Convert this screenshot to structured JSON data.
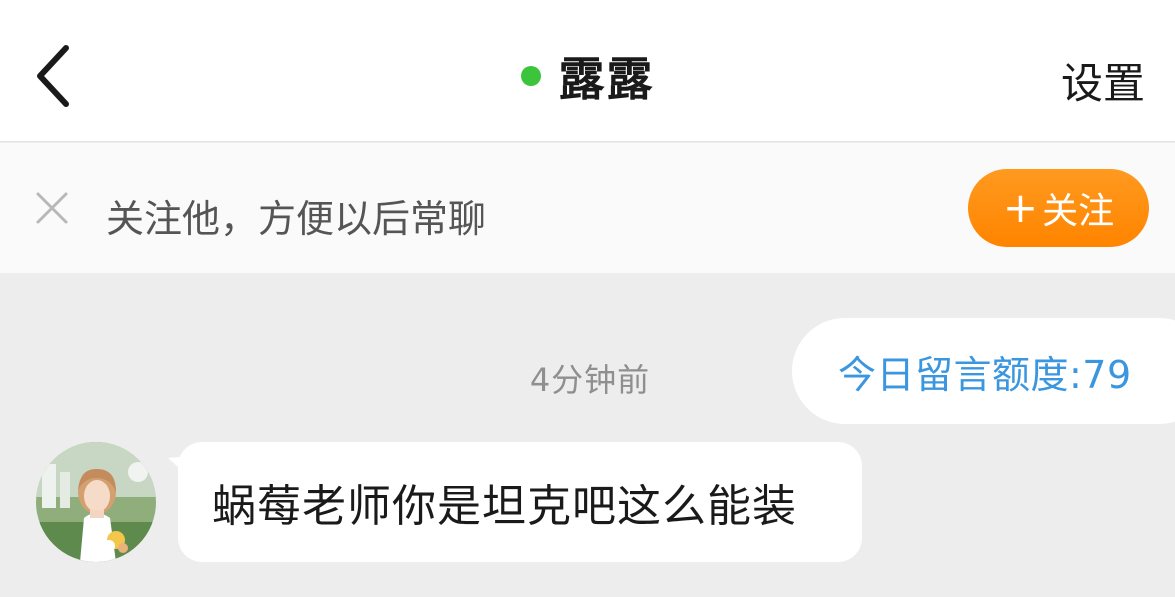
{
  "header": {
    "back_icon": "chevron-left-icon",
    "title": "露露",
    "online_color": "#3cc43c",
    "settings_label": "设置"
  },
  "follow_bar": {
    "close_icon": "close-icon",
    "text": "关注他，方便以后常聊",
    "button_label": "关注",
    "button_icon": "plus-icon",
    "button_gradient": [
      "#ff9a1f",
      "#ff8400"
    ]
  },
  "chat": {
    "quota_text": "今日留言额度:79",
    "quota_color": "#3b96e0",
    "timestamp": "4分钟前",
    "messages": [
      {
        "sender": "incoming",
        "avatar_icon": "avatar-bride-photo",
        "text": "蜗莓老师你是坦克吧这么能装"
      }
    ]
  }
}
